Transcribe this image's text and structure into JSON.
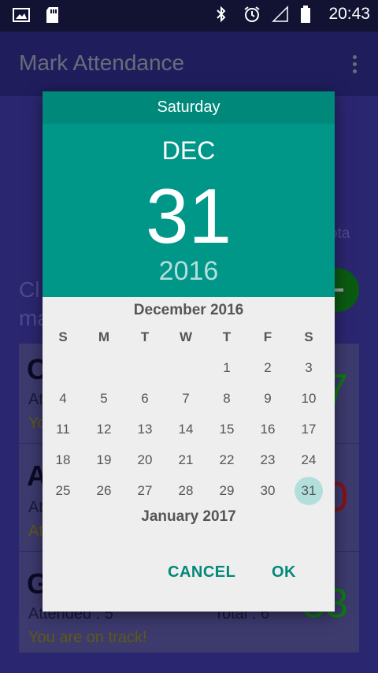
{
  "status_bar": {
    "time": "20:43"
  },
  "app_bar": {
    "title": "Mark Attendance"
  },
  "background": {
    "partial_text_right": "ota",
    "partial_heading_1": "Cl",
    "partial_heading_2": "ma",
    "cards": [
      {
        "initial": "C",
        "attended": "Atte",
        "track": "Yo",
        "big_value": "7",
        "big_color": "#0f7a12"
      },
      {
        "initial": "A",
        "attended": "Att",
        "track": "At",
        "big_value": "0",
        "big_color": "#8a1010"
      },
      {
        "initial": "G",
        "attended": "Attended : 5",
        "total": "Total : 6",
        "track": "You are on track!",
        "big_value": "83",
        "big_color": "#0f7a12"
      }
    ]
  },
  "date_picker": {
    "day_of_week": "Saturday",
    "month_short": "DEC",
    "day": "31",
    "year": "2016",
    "calendar_title": "December 2016",
    "weekday_headers": [
      "S",
      "M",
      "T",
      "W",
      "T",
      "F",
      "S"
    ],
    "first_weekday_index": 4,
    "days_in_month": 31,
    "selected_day": 31,
    "next_month_title": "January 2017",
    "cancel_label": "CANCEL",
    "ok_label": "OK",
    "accent_color": "#009688",
    "selection_color": "#b2dfdb"
  }
}
